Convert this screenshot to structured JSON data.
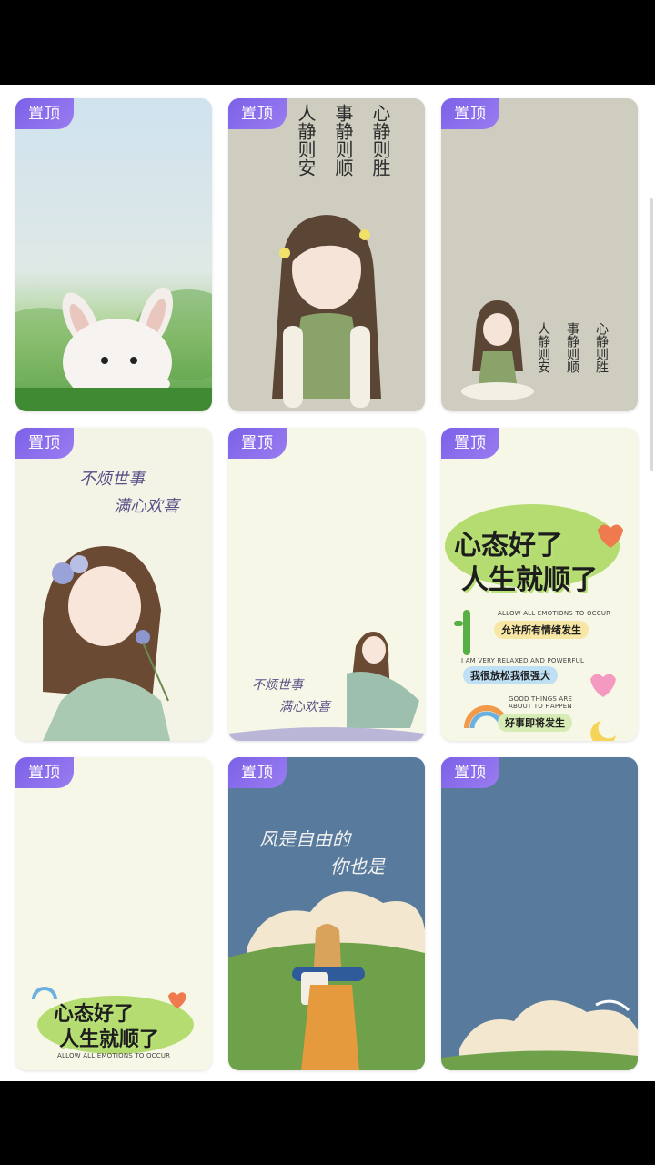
{
  "badge_label": "置顶",
  "cards": {
    "c2": {
      "poem": [
        "人静则安",
        "事静则顺",
        "心静则胜"
      ]
    },
    "c3": {
      "poem": [
        "人静则安",
        "事静则顺",
        "心静则胜"
      ]
    },
    "c4": {
      "line1": "不烦世事",
      "line2": "满心欢喜"
    },
    "c5": {
      "line1": "不烦世事",
      "line2": "满心欢喜"
    },
    "c6": {
      "title1": "心态好了",
      "title2": "人生就顺了",
      "en1": "ALLOW ALL EMOTIONS TO OCCUR",
      "cn1": "允许所有情绪发生",
      "en2": "I AM VERY RELAXED AND POWERFUL",
      "cn2": "我很放松我很强大",
      "en3": "GOOD THINGS ARE ABOUT TO HAPPEN",
      "cn3": "好事即将发生"
    },
    "c7": {
      "title1": "心态好了",
      "title2": "人生就顺了",
      "en1": "ALLOW ALL EMOTIONS TO OCCUR"
    },
    "c8": {
      "line1": "风是自由的",
      "line2": "你也是"
    }
  },
  "colors": {
    "badge": "#8a6cf0",
    "blue_bg": "#587a9c",
    "cream_bg": "#f6f7e6",
    "grey_bg": "#cfcdbf"
  }
}
